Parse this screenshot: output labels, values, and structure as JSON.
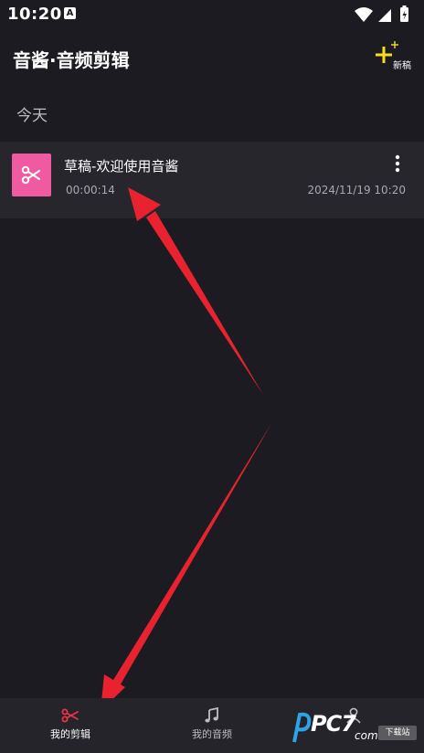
{
  "status_bar": {
    "time": "10:20",
    "app_icon_letter": "A",
    "icons": [
      "wifi-icon",
      "signal-icon",
      "battery-icon"
    ]
  },
  "header": {
    "title": "音酱·音频剪辑",
    "new_label": "新稿",
    "new_icon": "plus-icon",
    "accent_color": "#f5e11a"
  },
  "section": {
    "today": "今天"
  },
  "projects": [
    {
      "title": "草稿-欢迎使用音酱",
      "duration": "00:00:14",
      "date": "2024/11/19 10:20",
      "thumb_icon": "scissors-icon",
      "thumb_color": "#ef5aa1",
      "menu_icon": "more-vertical-icon"
    }
  ],
  "bottom_nav": {
    "items": [
      {
        "label": "我的剪辑",
        "icon": "scissors-icon",
        "active": true,
        "active_color": "#e8334a"
      },
      {
        "label": "我的音频",
        "icon": "music-note-icon",
        "active": false
      },
      {
        "label": "",
        "icon": "person-icon",
        "active": false
      }
    ]
  },
  "annotations": {
    "arrow_color": "#e8232f"
  },
  "watermark": {
    "text": "PC7",
    "suffix": "com",
    "badge": "下载站"
  }
}
